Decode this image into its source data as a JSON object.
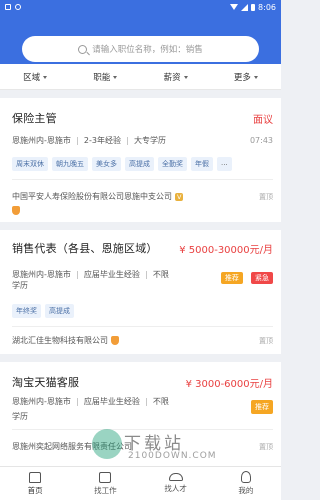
{
  "status_bar": {
    "time": "8:06"
  },
  "search": {
    "placeholder": "请输入职位名称，例如：销售"
  },
  "filters": [
    "区域",
    "职能",
    "薪资",
    "更多"
  ],
  "jobs": [
    {
      "title": "保险主管",
      "salary": "面议",
      "location": "恩施州内-恩施市",
      "experience": "2-3年经验",
      "education": "大专学历",
      "time": "07:43",
      "tags": [
        "周末双休",
        "朝九晚五",
        "美女多",
        "高提成",
        "全勤奖",
        "年假",
        "..."
      ],
      "company": "中国平安人寿保险股份有限公司恩施中支公司",
      "top_label": "置顶"
    },
    {
      "title": "销售代表（各县、恩施区域）",
      "salary": "¥ 5000-30000元/月",
      "location": "恩施州内-恩施市",
      "experience": "应届毕业生经验",
      "education_prefix": "不限",
      "education": "学历",
      "badges": [
        "推荐",
        "紧急"
      ],
      "tags": [
        "年终奖",
        "高提成"
      ],
      "company": "湖北汇佳生物科技有限公司",
      "top_label": "置顶"
    },
    {
      "title": "淘宝天猫客服",
      "salary": "¥ 3000-6000元/月",
      "location": "恩施州内-恩施市",
      "experience": "应届毕业生经验",
      "education_prefix": "不限",
      "education": "学历",
      "badges": [
        "推荐"
      ],
      "company": "恩施州奕起网络服务有限责任公司",
      "top_label": "置顶"
    }
  ],
  "nav": [
    "首页",
    "找工作",
    "找人才",
    "我的"
  ],
  "watermark": {
    "text": "下载站",
    "sub": "2100DOWN.COM"
  }
}
